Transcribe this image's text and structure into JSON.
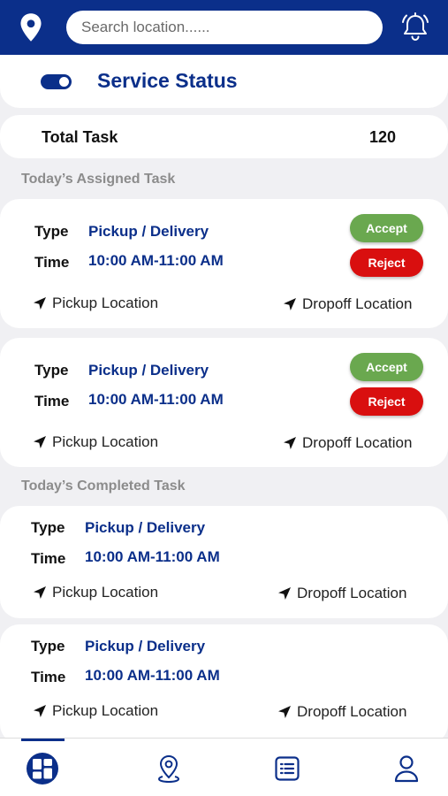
{
  "header": {
    "search_placeholder": "Search location......",
    "icons": [
      "location-pin-icon",
      "bell-icon"
    ]
  },
  "service_status": {
    "title": "Service Status",
    "enabled": true
  },
  "total_task": {
    "label": "Total Task",
    "value": "120"
  },
  "assigned_section": {
    "title": "Today’s Assigned Task",
    "tasks": [
      {
        "type_label": "Type",
        "type_value": "Pickup / Delivery",
        "time_label": "Time",
        "time_value": "10:00 AM-11:00 AM",
        "pickup_label": "Pickup Location",
        "dropoff_label": "Dropoff Location",
        "accept_label": "Accept",
        "reject_label": "Reject"
      },
      {
        "type_label": "Type",
        "type_value": "Pickup / Delivery",
        "time_label": "Time",
        "time_value": "10:00 AM-11:00 AM",
        "pickup_label": "Pickup Location",
        "dropoff_label": "Dropoff Location",
        "accept_label": "Accept",
        "reject_label": "Reject"
      }
    ]
  },
  "completed_section": {
    "title": "Today’s Completed Task",
    "tasks": [
      {
        "type_label": "Type",
        "type_value": "Pickup / Delivery",
        "time_label": "Time",
        "time_value": "10:00 AM-11:00 AM",
        "pickup_label": "Pickup Location",
        "dropoff_label": "Dropoff Location"
      },
      {
        "type_label": "Type",
        "type_value": "Pickup / Delivery",
        "time_label": "Time",
        "time_value": "10:00 AM-11:00 AM",
        "pickup_label": "Pickup Location",
        "dropoff_label": "Dropoff Location"
      }
    ]
  },
  "bottom_nav": {
    "items": [
      "dashboard-icon",
      "map-pin-icon",
      "task-list-icon",
      "profile-icon"
    ],
    "active": "dashboard-icon"
  },
  "colors": {
    "primary": "#0b2f8a",
    "accept": "#6aa84f",
    "reject": "#d90f0f",
    "section_title": "#8c8c8c",
    "background": "#f0f0f3"
  }
}
